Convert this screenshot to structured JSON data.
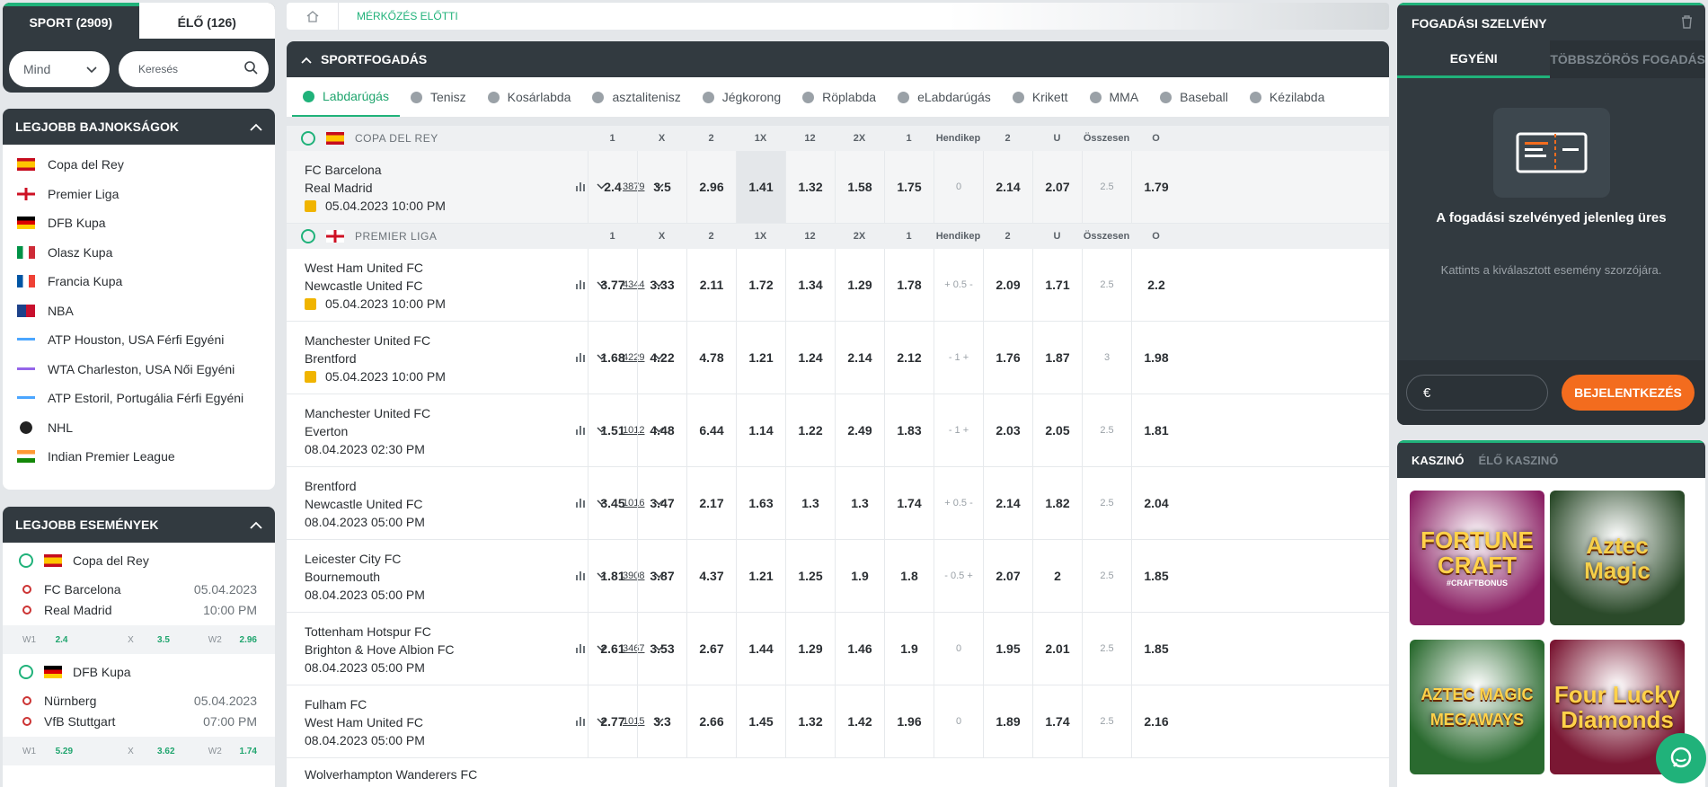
{
  "left": {
    "tab_sport": "SPORT (2909)",
    "tab_live": "ÉLŐ (126)",
    "filter_value": "Mind",
    "search_placeholder": "Keresés",
    "top_leagues_title": "LEGJOBB BAJNOKSÁGOK",
    "leagues": [
      {
        "label": "Copa del Rey",
        "icon": "spain-flag-icon"
      },
      {
        "label": "Premier Liga",
        "icon": "england-flag-icon"
      },
      {
        "label": "DFB Kupa",
        "icon": "germany-flag-icon"
      },
      {
        "label": "Olasz Kupa",
        "icon": "italy-flag-icon"
      },
      {
        "label": "Francia Kupa",
        "icon": "france-flag-icon"
      },
      {
        "label": "NBA",
        "icon": "nba-logo-icon"
      },
      {
        "label": "ATP Houston, USA Férfi Egyéni",
        "icon": "atp-logo-icon"
      },
      {
        "label": "WTA Charleston, USA Női Egyéni",
        "icon": "wta-logo-icon"
      },
      {
        "label": "ATP Estoril, Portugália Férfi Egyéni",
        "icon": "atp-logo-icon"
      },
      {
        "label": "NHL",
        "icon": "nhl-logo-icon"
      },
      {
        "label": "Indian Premier League",
        "icon": "india-flag-icon"
      }
    ],
    "top_events_title": "LEGJOBB ESEMÉNYEK",
    "events": [
      {
        "league": "Copa del Rey",
        "home": "FC Barcelona",
        "away": "Real Madrid",
        "date": "05.04.2023",
        "time": "10:00 PM",
        "w1_label": "W1",
        "w1": "2.4",
        "x_label": "X",
        "x": "3.5",
        "w2_label": "W2",
        "w2": "2.96"
      },
      {
        "league": "DFB Kupa",
        "home": "Nürnberg",
        "away": "VfB Stuttgart",
        "date": "05.04.2023",
        "time": "07:00 PM",
        "w1_label": "W1",
        "w1": "5.29",
        "x_label": "X",
        "x": "3.62",
        "w2_label": "W2",
        "w2": "1.74"
      }
    ]
  },
  "center": {
    "breadcrumb": "MÉRKŐZÉS ELŐTTI",
    "section_title": "SPORTFOGADÁS",
    "sports": [
      "Labdarúgás",
      "Tenisz",
      "Kosárlabda",
      "asztalitenisz",
      "Jégkorong",
      "Röplabda",
      "eLabdarúgás",
      "Krikett",
      "MMA",
      "Baseball",
      "Kézilabda"
    ],
    "columns": [
      "1",
      "X",
      "2",
      "1X",
      "12",
      "2X",
      "1",
      "Hendikep",
      "2",
      "U",
      "Összesen",
      "O"
    ],
    "leagues": [
      {
        "name": "COPA DEL REY",
        "matches": [
          {
            "home": "FC Barcelona",
            "away": "Real Madrid",
            "datetime": "05.04.2023 10:00 PM",
            "count": "3879",
            "odds": [
              "2.4",
              "3.5",
              "2.96",
              "1.41",
              "1.32",
              "1.58",
              "1.75",
              "0",
              "2.14",
              "2.07",
              "2.5",
              "1.79"
            ]
          }
        ]
      },
      {
        "name": "PREMIER LIGA",
        "matches": [
          {
            "home": "West Ham United FC",
            "away": "Newcastle United FC",
            "datetime": "05.04.2023 10:00 PM",
            "count": "4344",
            "odds": [
              "3.77",
              "3.33",
              "2.11",
              "1.72",
              "1.34",
              "1.29",
              "1.78",
              "+ 0.5 -",
              "2.09",
              "1.71",
              "2.5",
              "2.2"
            ]
          },
          {
            "home": "Manchester United FC",
            "away": "Brentford",
            "datetime": "05.04.2023 10:00 PM",
            "count": "4229",
            "odds": [
              "1.68",
              "4.22",
              "4.78",
              "1.21",
              "1.24",
              "2.14",
              "2.12",
              "- 1 +",
              "1.76",
              "1.87",
              "3",
              "1.98"
            ]
          },
          {
            "home": "Manchester United FC",
            "away": "Everton",
            "datetime": "08.04.2023 02:30 PM",
            "count": "1012",
            "odds": [
              "1.51",
              "4.48",
              "6.44",
              "1.14",
              "1.22",
              "2.49",
              "1.83",
              "- 1 +",
              "2.03",
              "2.05",
              "2.5",
              "1.81"
            ]
          },
          {
            "home": "Brentford",
            "away": "Newcastle United FC",
            "datetime": "08.04.2023 05:00 PM",
            "count": "1016",
            "odds": [
              "3.45",
              "3.47",
              "2.17",
              "1.63",
              "1.3",
              "1.3",
              "1.74",
              "+ 0.5 -",
              "2.14",
              "1.82",
              "2.5",
              "2.04"
            ]
          },
          {
            "home": "Leicester City FC",
            "away": "Bournemouth",
            "datetime": "08.04.2023 05:00 PM",
            "count": "3908",
            "odds": [
              "1.81",
              "3.87",
              "4.37",
              "1.21",
              "1.25",
              "1.9",
              "1.8",
              "- 0.5 +",
              "2.07",
              "2",
              "2.5",
              "1.85"
            ]
          },
          {
            "home": "Tottenham Hotspur FC",
            "away": "Brighton & Hove Albion FC",
            "datetime": "08.04.2023 05:00 PM",
            "count": "3467",
            "odds": [
              "2.61",
              "3.53",
              "2.67",
              "1.44",
              "1.29",
              "1.46",
              "1.9",
              "0",
              "1.95",
              "2.01",
              "2.5",
              "1.85"
            ]
          },
          {
            "home": "Fulham FC",
            "away": "West Ham United FC",
            "datetime": "08.04.2023 05:00 PM",
            "count": "1015",
            "odds": [
              "2.77",
              "3.3",
              "2.66",
              "1.45",
              "1.32",
              "1.42",
              "1.96",
              "0",
              "1.89",
              "1.74",
              "2.5",
              "2.16"
            ]
          },
          {
            "home": "Wolverhampton Wanderers FC",
            "away": "",
            "datetime": "",
            "count": "",
            "odds": []
          }
        ]
      }
    ]
  },
  "right": {
    "slip_title": "FOGADÁSI SZELVÉNY",
    "tab_single": "EGYÉNI",
    "tab_multi": "TÖBBSZÖRÖS FOGADÁS",
    "empty_title": "A fogadási szelvényed jelenleg üres",
    "empty_sub": "Kattints a kiválasztott esemény szorzójára.",
    "currency": "€",
    "login": "BEJELENTKEZÉS",
    "casino_tab": "KASZINÓ",
    "live_casino_tab": "ÉLŐ KASZINÓ",
    "games": [
      {
        "title": "FORTUNE CRAFT",
        "sub": "#CRAFTBONUS",
        "color": "#8a1f63"
      },
      {
        "title": "Aztec Magic",
        "sub": "",
        "color": "#2b4a2a"
      },
      {
        "title": "AZTEC MAGIC MEGAWAYS",
        "sub": "",
        "color": "#2a6a2f"
      },
      {
        "title": "Four Lucky Diamonds",
        "sub": "",
        "color": "#7a1733"
      }
    ]
  },
  "colors": {
    "accent": "#20b27a",
    "dark": "#323a40",
    "orange": "#f36c1e"
  }
}
